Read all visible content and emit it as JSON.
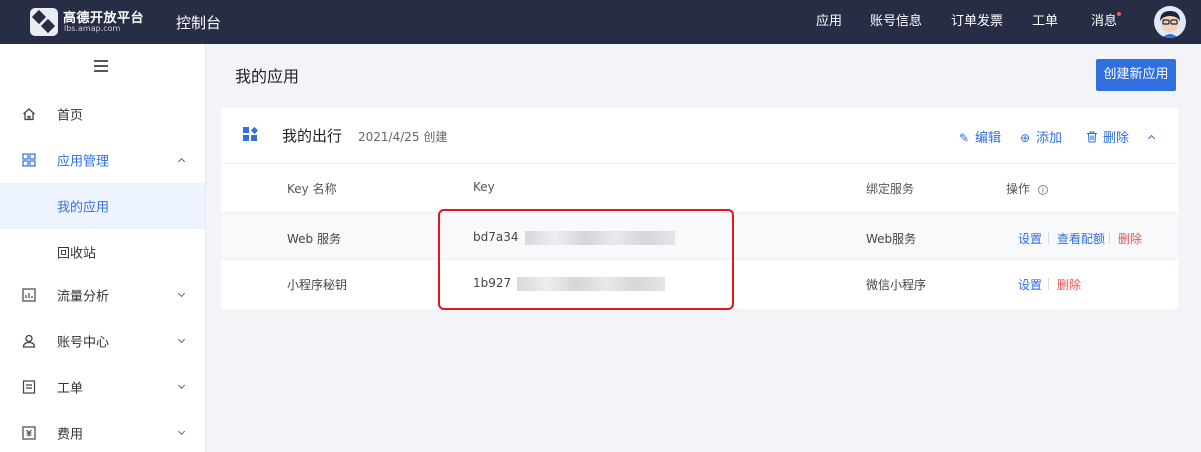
{
  "brand": {
    "name": "高德开放平台",
    "domain": "lbs.amap.com",
    "console": "控制台"
  },
  "topnav": [
    "应用",
    "账号信息",
    "订单发票",
    "工单",
    "消息"
  ],
  "sidebar": {
    "items": [
      {
        "label": "首页",
        "icon": "home-icon"
      },
      {
        "label": "应用管理",
        "icon": "grid-icon",
        "expanded": true
      },
      {
        "label": "我的应用",
        "active": true
      },
      {
        "label": "回收站"
      },
      {
        "label": "流量分析",
        "icon": "chart-icon"
      },
      {
        "label": "账号中心",
        "icon": "user-icon"
      },
      {
        "label": "工单",
        "icon": "ticket-icon"
      },
      {
        "label": "费用",
        "icon": "fee-icon"
      }
    ]
  },
  "main": {
    "title": "我的应用",
    "create_button": "创建新应用",
    "app": {
      "name": "我的出行",
      "created": "2021/4/25 创建",
      "actions": {
        "edit": "编辑",
        "add": "添加",
        "delete": "删除"
      },
      "columns": [
        "Key 名称",
        "Key",
        "绑定服务",
        "操作"
      ],
      "keys": [
        {
          "name": "Web 服务",
          "key": "bd7a34",
          "service": "Web服务",
          "ops": [
            "设置",
            "查看配额",
            "删除"
          ]
        },
        {
          "name": "小程序秘钥",
          "key": "1b927",
          "service": "微信小程序",
          "ops": [
            "设置",
            "删除"
          ]
        }
      ]
    }
  },
  "colors": {
    "topbar": "#262d45",
    "accent": "#2f6fe0",
    "danger": "#ef5350",
    "highlight": "#e4161b"
  }
}
